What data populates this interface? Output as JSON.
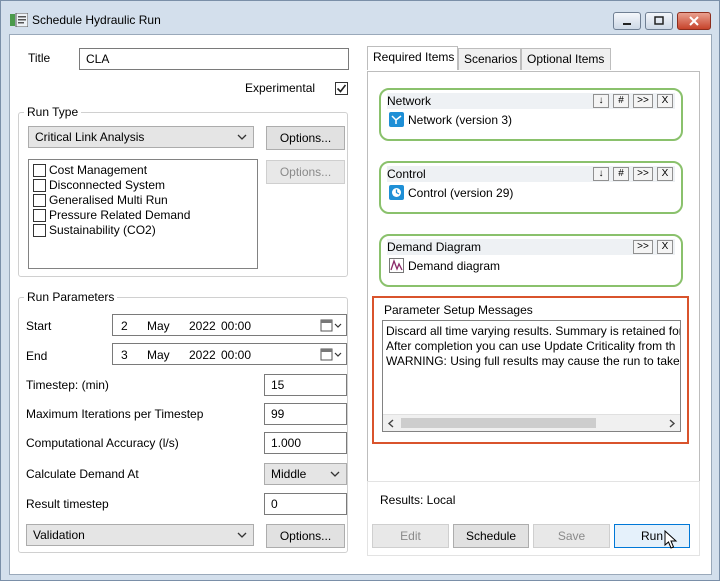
{
  "window": {
    "title": "Schedule Hydraulic Run",
    "minimize_icon": "minimize-icon",
    "maximize_icon": "maximize-icon",
    "close_icon": "close-icon"
  },
  "title_field": {
    "label": "Title",
    "value": "CLA"
  },
  "experimental": {
    "label": "Experimental",
    "checked": true
  },
  "run_type": {
    "group_label": "Run Type",
    "selected": "Critical Link Analysis",
    "options_label": "Options...",
    "options2_label": "Options...",
    "checklist": [
      {
        "label": "Cost Management",
        "checked": false
      },
      {
        "label": "Disconnected System",
        "checked": false
      },
      {
        "label": "Generalised Multi Run",
        "checked": false
      },
      {
        "label": "Pressure Related Demand",
        "checked": false
      },
      {
        "label": "Sustainability (CO2)",
        "checked": false
      }
    ]
  },
  "run_parameters": {
    "group_label": "Run Parameters",
    "start": {
      "label": "Start",
      "day": "2",
      "month": "May",
      "year": "2022",
      "time": "00:00"
    },
    "end": {
      "label": "End",
      "day": "3",
      "month": "May",
      "year": "2022",
      "time": "00:00"
    },
    "timestep": {
      "label": "Timestep: (min)",
      "value": "15"
    },
    "max_iter": {
      "label": "Maximum Iterations per Timestep",
      "value": "99"
    },
    "accuracy": {
      "label": "Computational Accuracy (l/s)",
      "value": "1.000"
    },
    "demand_at": {
      "label": "Calculate Demand At",
      "value": "Middle"
    },
    "result_timestep": {
      "label": "Result timestep",
      "value": "0"
    },
    "validation": {
      "selected": "Validation",
      "options_label": "Options..."
    }
  },
  "tabs": [
    {
      "label": "Required Items",
      "active": true
    },
    {
      "label": "Scenarios",
      "active": false
    },
    {
      "label": "Optional Items",
      "active": false
    }
  ],
  "items": {
    "network": {
      "title": "Network",
      "value": "Network (version 3)",
      "buttons": [
        "↓",
        "#",
        ">>",
        "X"
      ]
    },
    "control": {
      "title": "Control",
      "value": "Control (version 29)",
      "buttons": [
        "↓",
        "#",
        ">>",
        "X"
      ]
    },
    "demand": {
      "title": "Demand Diagram",
      "value": "Demand diagram",
      "buttons": [
        ">>",
        "X"
      ]
    }
  },
  "messages": {
    "label": "Parameter Setup Messages",
    "lines": [
      "Discard all time varying results. Summary is retained for",
      "After completion you can use Update Criticality from th",
      "WARNING: Using full results may cause the run to take m"
    ]
  },
  "results": {
    "label": "Results: Local",
    "edit_label": "Edit",
    "schedule_label": "Schedule",
    "save_label": "Save",
    "run_label": "Run"
  },
  "colors": {
    "accent": "#0078d7",
    "item_border": "#8ac16c",
    "highlight": "#d9532c"
  }
}
